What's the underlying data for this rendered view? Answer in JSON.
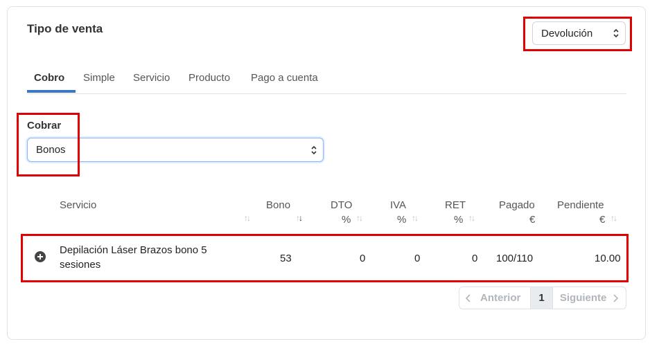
{
  "header": {
    "title": "Tipo de venta",
    "sale_type_select": "Devolución"
  },
  "tabs": [
    {
      "label": "Cobro",
      "active": true
    },
    {
      "label": "Simple",
      "active": false
    },
    {
      "label": "Servicio",
      "active": false
    },
    {
      "label": "Producto",
      "active": false
    },
    {
      "label": "Pago a cuenta",
      "active": false
    }
  ],
  "cobrar": {
    "label": "Cobrar",
    "select_value": "Bonos"
  },
  "table": {
    "columns": [
      {
        "line1": "Servicio",
        "line2": ""
      },
      {
        "line1": "Bono",
        "line2": ""
      },
      {
        "line1": "DTO",
        "line2": "%"
      },
      {
        "line1": "IVA",
        "line2": "%"
      },
      {
        "line1": "RET",
        "line2": "%"
      },
      {
        "line1": "Pagado",
        "line2": "€"
      },
      {
        "line1": "Pendiente",
        "line2": "€"
      }
    ],
    "rows": [
      {
        "servicio_line1": "Depilación Láser Brazos bono 5",
        "servicio_line2": "sesiones",
        "bono": "53",
        "dto": "0",
        "iva": "0",
        "ret": "0",
        "pagado": "100/110",
        "pendiente": "10.00"
      }
    ]
  },
  "pagination": {
    "prev": "Anterior",
    "page": "1",
    "next": "Siguiente"
  },
  "colors": {
    "highlight": "#e00000",
    "accent": "#3a78c3"
  }
}
